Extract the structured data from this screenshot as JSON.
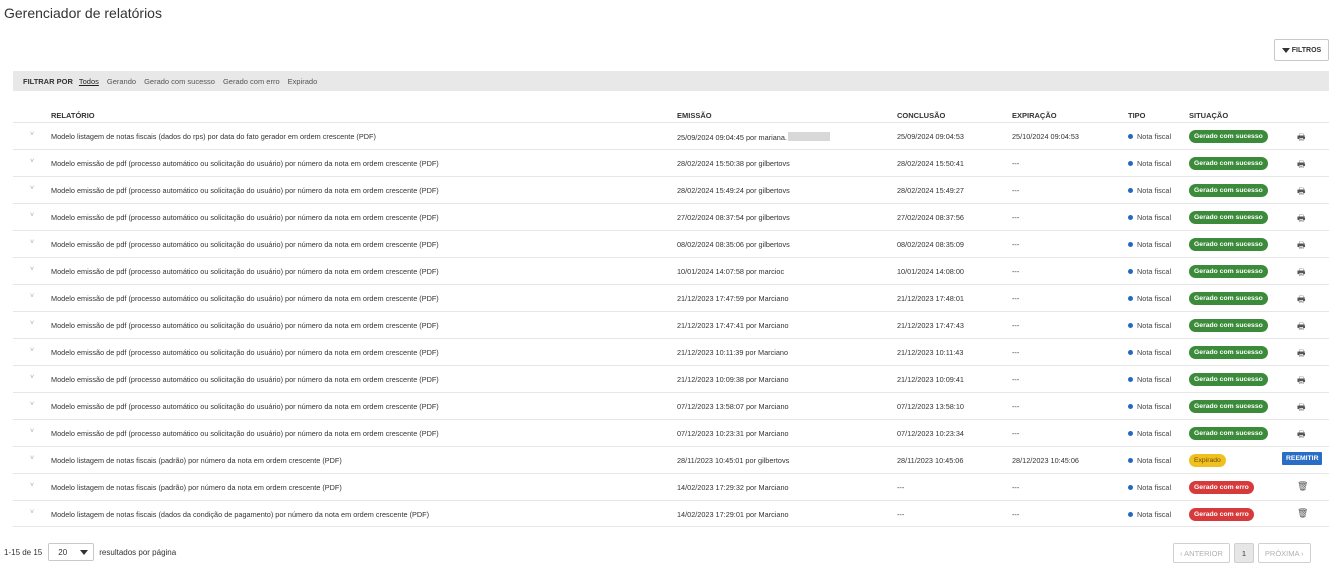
{
  "page_title": "Gerenciador de relatórios",
  "filters_button": {
    "label": "FILTROS",
    "icon": "funnel-icon"
  },
  "filterbar": {
    "label": "FILTRAR POR",
    "options": [
      "Todos",
      "Gerando",
      "Gerado com sucesso",
      "Gerado com erro",
      "Expirado"
    ],
    "active": "Todos"
  },
  "columns": {
    "relatorio": "RELATÓRIO",
    "emissao": "EMISSÃO",
    "conclusao": "CONCLUSÃO",
    "expiracao": "EXPIRAÇÃO",
    "tipo": "TIPO",
    "situacao": "SITUAÇÃO"
  },
  "rows": [
    {
      "relatorio": "Modelo listagem de notas fiscais (dados do rps) por data do fato gerador em ordem crescente (PDF)",
      "emissao": "25/09/2024 09:04:45 por mariana.",
      "redacted": true,
      "conclusao": "25/09/2024 09:04:53",
      "expiracao": "25/10/2024 09:04:53",
      "tipo": "Nota fiscal",
      "situacao": "Gerado com sucesso",
      "status": "success",
      "action": "print"
    },
    {
      "relatorio": "Modelo emissão de pdf (processo automático ou solicitação do usuário) por número da nota em ordem crescente (PDF)",
      "emissao": "28/02/2024 15:50:38 por gilbertovs",
      "conclusao": "28/02/2024 15:50:41",
      "expiracao": "---",
      "tipo": "Nota fiscal",
      "situacao": "Gerado com sucesso",
      "status": "success",
      "action": "print"
    },
    {
      "relatorio": "Modelo emissão de pdf (processo automático ou solicitação do usuário) por número da nota em ordem crescente (PDF)",
      "emissao": "28/02/2024 15:49:24 por gilbertovs",
      "conclusao": "28/02/2024 15:49:27",
      "expiracao": "---",
      "tipo": "Nota fiscal",
      "situacao": "Gerado com sucesso",
      "status": "success",
      "action": "print"
    },
    {
      "relatorio": "Modelo emissão de pdf (processo automático ou solicitação do usuário) por número da nota em ordem crescente (PDF)",
      "emissao": "27/02/2024 08:37:54 por gilbertovs",
      "conclusao": "27/02/2024 08:37:56",
      "expiracao": "---",
      "tipo": "Nota fiscal",
      "situacao": "Gerado com sucesso",
      "status": "success",
      "action": "print"
    },
    {
      "relatorio": "Modelo emissão de pdf (processo automático ou solicitação do usuário) por número da nota em ordem crescente (PDF)",
      "emissao": "08/02/2024 08:35:06 por gilbertovs",
      "conclusao": "08/02/2024 08:35:09",
      "expiracao": "---",
      "tipo": "Nota fiscal",
      "situacao": "Gerado com sucesso",
      "status": "success",
      "action": "print"
    },
    {
      "relatorio": "Modelo emissão de pdf (processo automático ou solicitação do usuário) por número da nota em ordem crescente (PDF)",
      "emissao": "10/01/2024 14:07:58 por marcioc",
      "conclusao": "10/01/2024 14:08:00",
      "expiracao": "---",
      "tipo": "Nota fiscal",
      "situacao": "Gerado com sucesso",
      "status": "success",
      "action": "print"
    },
    {
      "relatorio": "Modelo emissão de pdf (processo automático ou solicitação do usuário) por número da nota em ordem crescente (PDF)",
      "emissao": "21/12/2023 17:47:59 por Marciano",
      "conclusao": "21/12/2023 17:48:01",
      "expiracao": "---",
      "tipo": "Nota fiscal",
      "situacao": "Gerado com sucesso",
      "status": "success",
      "action": "print"
    },
    {
      "relatorio": "Modelo emissão de pdf (processo automático ou solicitação do usuário) por número da nota em ordem crescente (PDF)",
      "emissao": "21/12/2023 17:47:41 por Marciano",
      "conclusao": "21/12/2023 17:47:43",
      "expiracao": "---",
      "tipo": "Nota fiscal",
      "situacao": "Gerado com sucesso",
      "status": "success",
      "action": "print"
    },
    {
      "relatorio": "Modelo emissão de pdf (processo automático ou solicitação do usuário) por número da nota em ordem crescente (PDF)",
      "emissao": "21/12/2023 10:11:39 por Marciano",
      "conclusao": "21/12/2023 10:11:43",
      "expiracao": "---",
      "tipo": "Nota fiscal",
      "situacao": "Gerado com sucesso",
      "status": "success",
      "action": "print"
    },
    {
      "relatorio": "Modelo emissão de pdf (processo automático ou solicitação do usuário) por número da nota em ordem crescente (PDF)",
      "emissao": "21/12/2023 10:09:38 por Marciano",
      "conclusao": "21/12/2023 10:09:41",
      "expiracao": "---",
      "tipo": "Nota fiscal",
      "situacao": "Gerado com sucesso",
      "status": "success",
      "action": "print"
    },
    {
      "relatorio": "Modelo emissão de pdf (processo automático ou solicitação do usuário) por número da nota em ordem crescente (PDF)",
      "emissao": "07/12/2023 13:58:07 por Marciano",
      "conclusao": "07/12/2023 13:58:10",
      "expiracao": "---",
      "tipo": "Nota fiscal",
      "situacao": "Gerado com sucesso",
      "status": "success",
      "action": "print"
    },
    {
      "relatorio": "Modelo emissão de pdf (processo automático ou solicitação do usuário) por número da nota em ordem crescente (PDF)",
      "emissao": "07/12/2023 10:23:31 por Marciano",
      "conclusao": "07/12/2023 10:23:34",
      "expiracao": "---",
      "tipo": "Nota fiscal",
      "situacao": "Gerado com sucesso",
      "status": "success",
      "action": "print"
    },
    {
      "relatorio": "Modelo listagem de notas fiscais (padrão) por número da nota em ordem crescente (PDF)",
      "emissao": "28/11/2023 10:45:01 por gilbertovs",
      "conclusao": "28/11/2023 10:45:06",
      "expiracao": "28/12/2023 10:45:06",
      "tipo": "Nota fiscal",
      "situacao": "Expirado",
      "status": "expired",
      "action": "reemit",
      "action_label": "REEMITIR"
    },
    {
      "relatorio": "Modelo listagem de notas fiscais (padrão) por número da nota em ordem crescente (PDF)",
      "emissao": "14/02/2023 17:29:32 por Marciano",
      "conclusao": "---",
      "expiracao": "---",
      "tipo": "Nota fiscal",
      "situacao": "Gerado com erro",
      "status": "error",
      "action": "delete"
    },
    {
      "relatorio": "Modelo listagem de notas fiscais (dados da condição de pagamento) por número da nota em ordem crescente (PDF)",
      "emissao": "14/02/2023 17:29:01 por Marciano",
      "conclusao": "---",
      "expiracao": "---",
      "tipo": "Nota fiscal",
      "situacao": "Gerado com erro",
      "status": "error",
      "action": "delete"
    }
  ],
  "footer": {
    "range": "1-15 de 15",
    "page_size": "20",
    "per_page_label": "resultados por página"
  },
  "pagination": {
    "prev": "‹ ANTERIOR",
    "current": "1",
    "next": "PRÓXIMA ›"
  }
}
